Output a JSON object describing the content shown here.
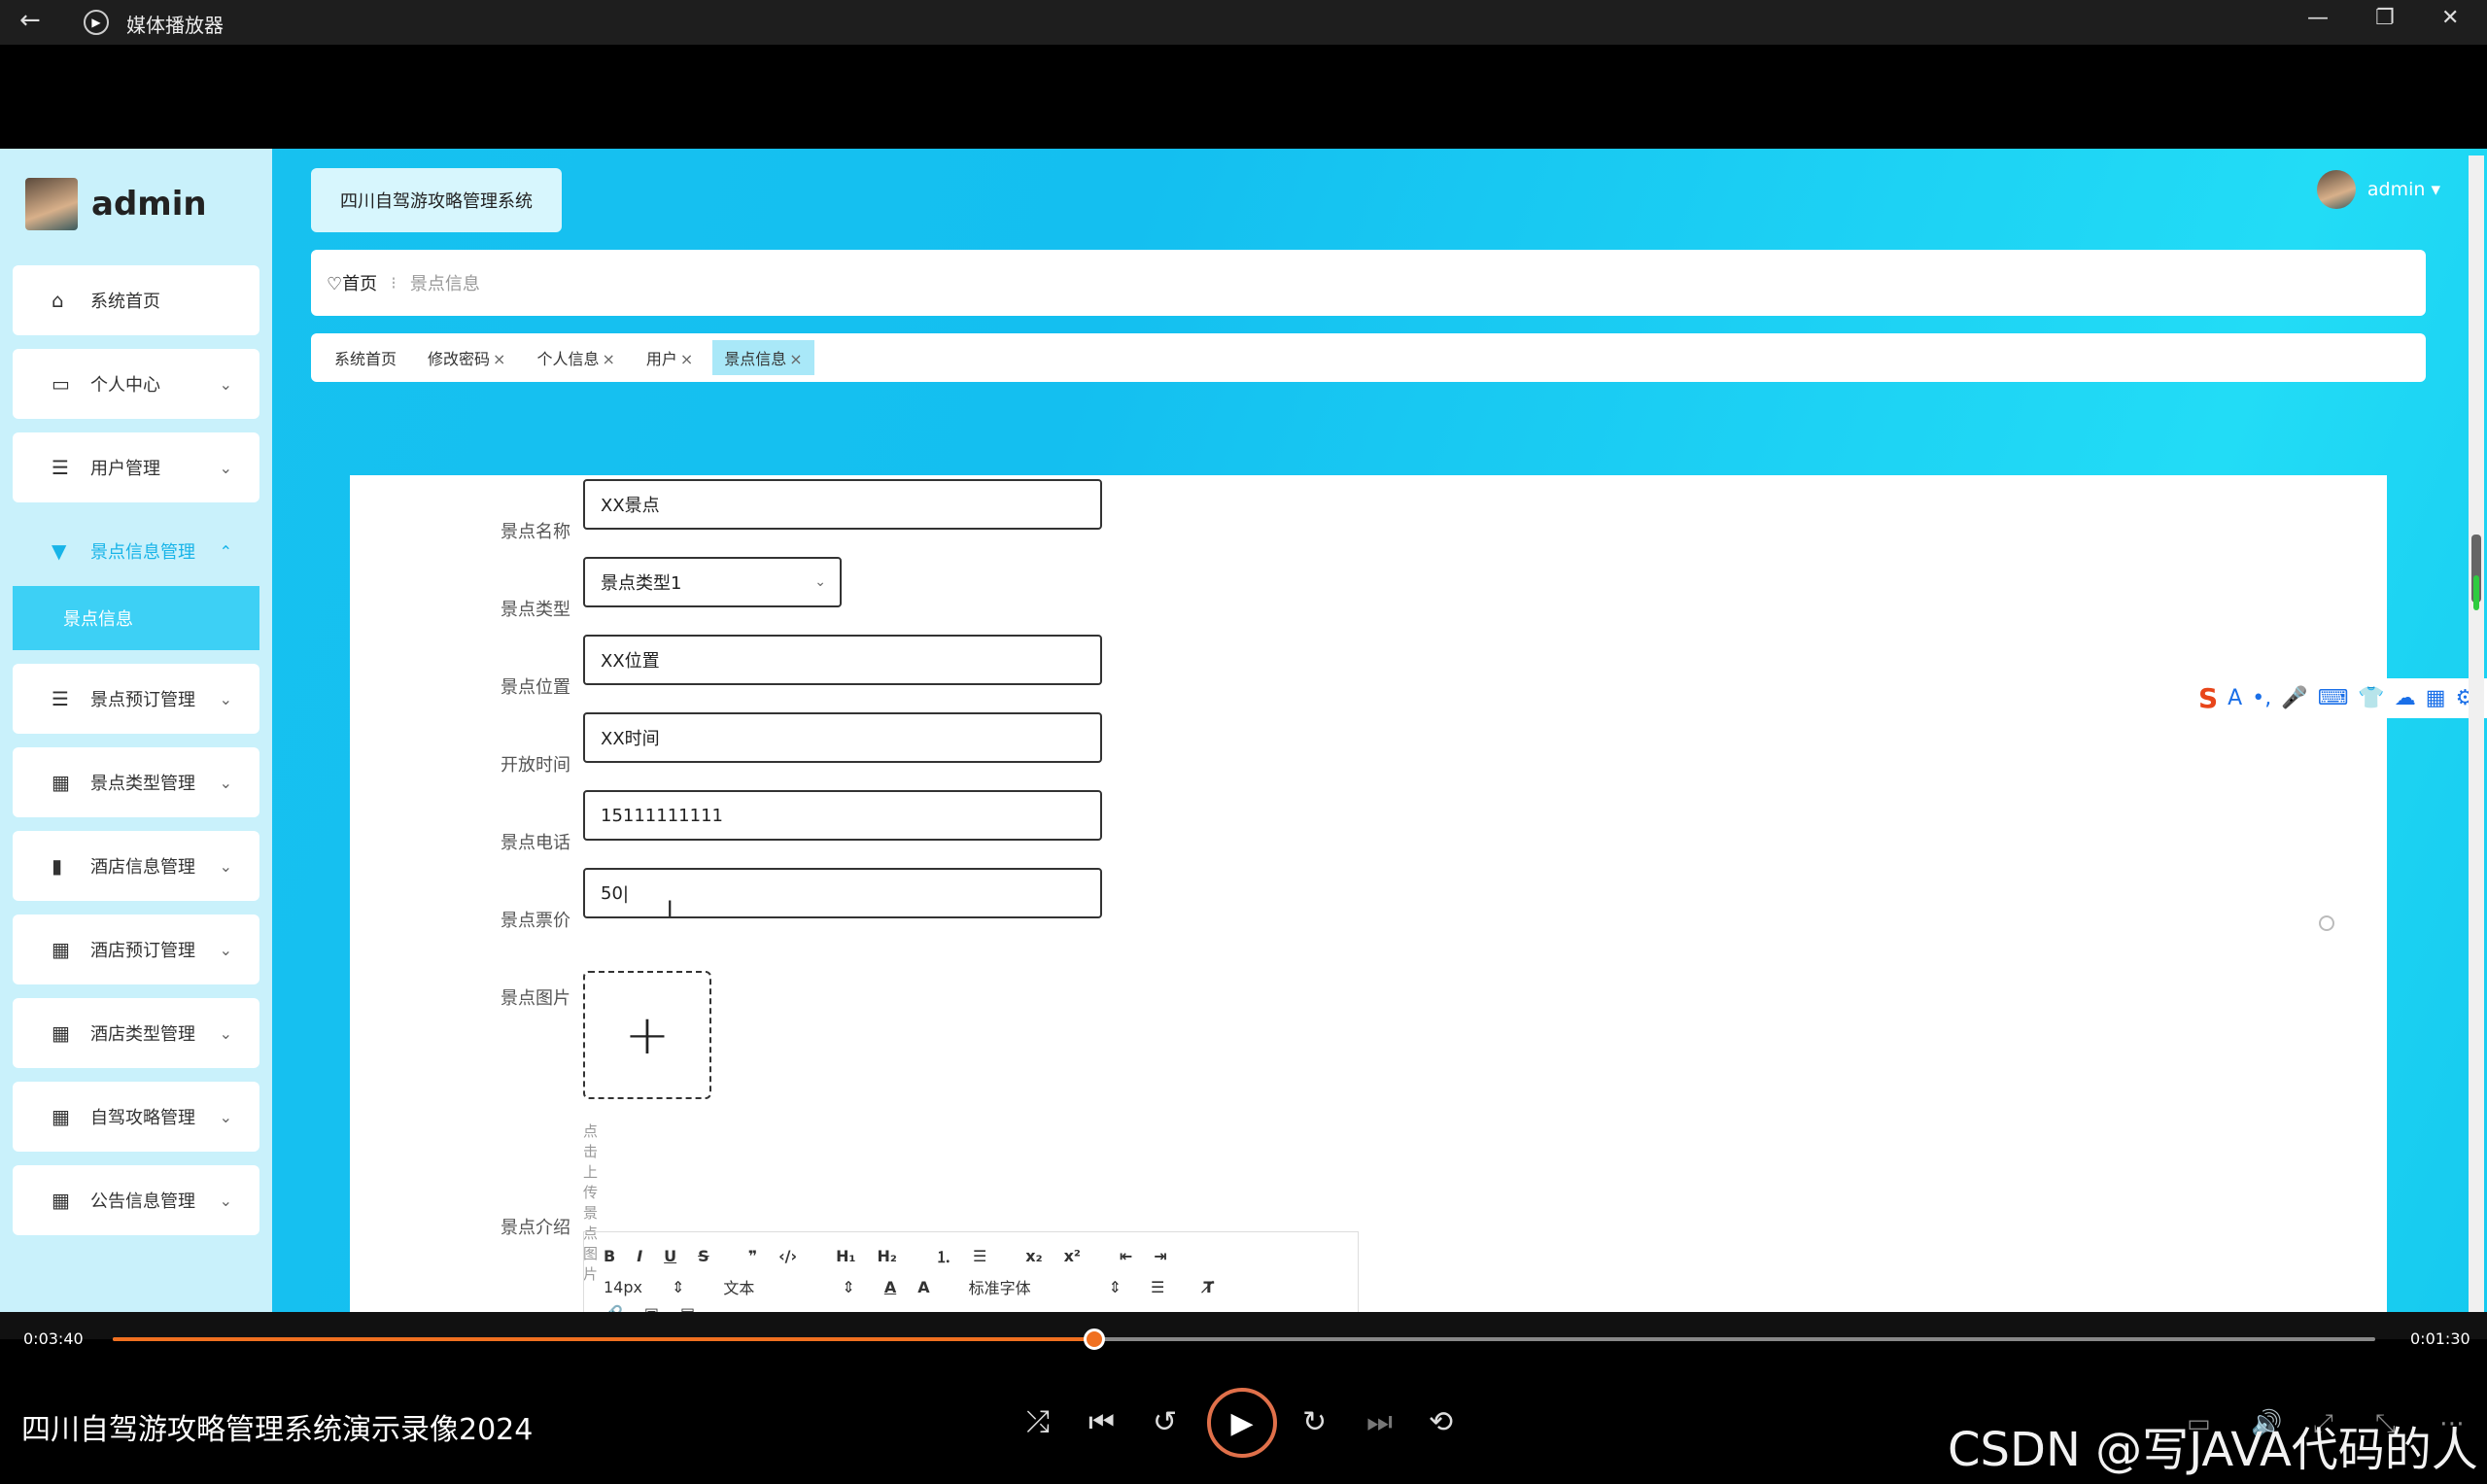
{
  "window": {
    "title": "媒体播放器",
    "back_icon": "←",
    "app_icon": "▶",
    "minimize": "—",
    "restore": "❐",
    "close": "✕"
  },
  "app": {
    "brand_name": "admin",
    "system_title": "四川自驾游攻略管理系统",
    "user_name": "admin",
    "user_caret": "▾"
  },
  "sidebar": {
    "items": [
      {
        "label": "系统首页",
        "icon": "⌂",
        "chev": ""
      },
      {
        "label": "个人中心",
        "icon": "▭",
        "chev": "⌄"
      },
      {
        "label": "用户管理",
        "icon": "☰",
        "chev": "⌄"
      },
      {
        "label": "景点信息管理",
        "icon": "▼",
        "chev": "⌃"
      },
      {
        "label": "景点预订管理",
        "icon": "☰",
        "chev": "⌄"
      },
      {
        "label": "景点类型管理",
        "icon": "▦",
        "chev": "⌄"
      },
      {
        "label": "酒店信息管理",
        "icon": "▮",
        "chev": "⌄"
      },
      {
        "label": "酒店预订管理",
        "icon": "▦",
        "chev": "⌄"
      },
      {
        "label": "酒店类型管理",
        "icon": "▦",
        "chev": "⌄"
      },
      {
        "label": "自驾攻略管理",
        "icon": "▦",
        "chev": "⌄"
      },
      {
        "label": "公告信息管理",
        "icon": "▦",
        "chev": "⌄"
      }
    ],
    "active_sub": "景点信息"
  },
  "breadcrumb": {
    "home": "♡首页",
    "sep": "⁝",
    "current": "景点信息"
  },
  "tabs": [
    {
      "label": "系统首页",
      "close": ""
    },
    {
      "label": "修改密码",
      "close": "×"
    },
    {
      "label": "个人信息",
      "close": "×"
    },
    {
      "label": "用户",
      "close": "×"
    },
    {
      "label": "景点信息",
      "close": "×"
    }
  ],
  "form": {
    "name_label": "景点名称",
    "name_value": "XX景点",
    "type_label": "景点类型",
    "type_value": "景点类型1",
    "type_arrow": "⌄",
    "location_label": "景点位置",
    "location_value": "XX位置",
    "open_label": "开放时间",
    "open_value": "XX时间",
    "phone_label": "景点电话",
    "phone_value": "15111111111",
    "price_label": "景点票价",
    "price_value": "50|",
    "image_label": "景点图片",
    "upload_plus": "+",
    "upload_tip": "点击上传景点图片",
    "intro_label": "景点介绍"
  },
  "editor": {
    "row1": [
      "B",
      "I",
      "U",
      "S",
      "❞",
      "‹/›",
      "H₁",
      "H₂",
      "⒈",
      "☰",
      "x₂",
      "x²",
      "⇤",
      "⇥"
    ],
    "size_value": "14px",
    "format_value": "文本",
    "font_value": "标准字体",
    "sel_arrow": "⇕",
    "color_a": "A",
    "bg_a": "A",
    "align": "☰",
    "clear": "T̸",
    "row3": [
      "🔗",
      "▣",
      "▤"
    ]
  },
  "ime": {
    "items": [
      "S",
      "A",
      "•,",
      "🎤",
      "⌨",
      "👕",
      "☁",
      "▦",
      "⚙"
    ]
  },
  "player": {
    "current_time": "0:03:40",
    "total_time": "0:01:30",
    "progress": 0.434,
    "video_title": "四川自驾游攻略管理系统演示录像2024",
    "shuffle": "⤮",
    "prev": "⏮",
    "back10": "↺",
    "play": "▶",
    "fwd30": "↻",
    "next": "⏭",
    "repeat": "⟲",
    "right_icons": [
      "▭",
      "🔊",
      "⤢",
      "⤡",
      "⋯"
    ],
    "accent": "#f07020"
  },
  "watermark": "CSDN @写JAVA代码的人"
}
